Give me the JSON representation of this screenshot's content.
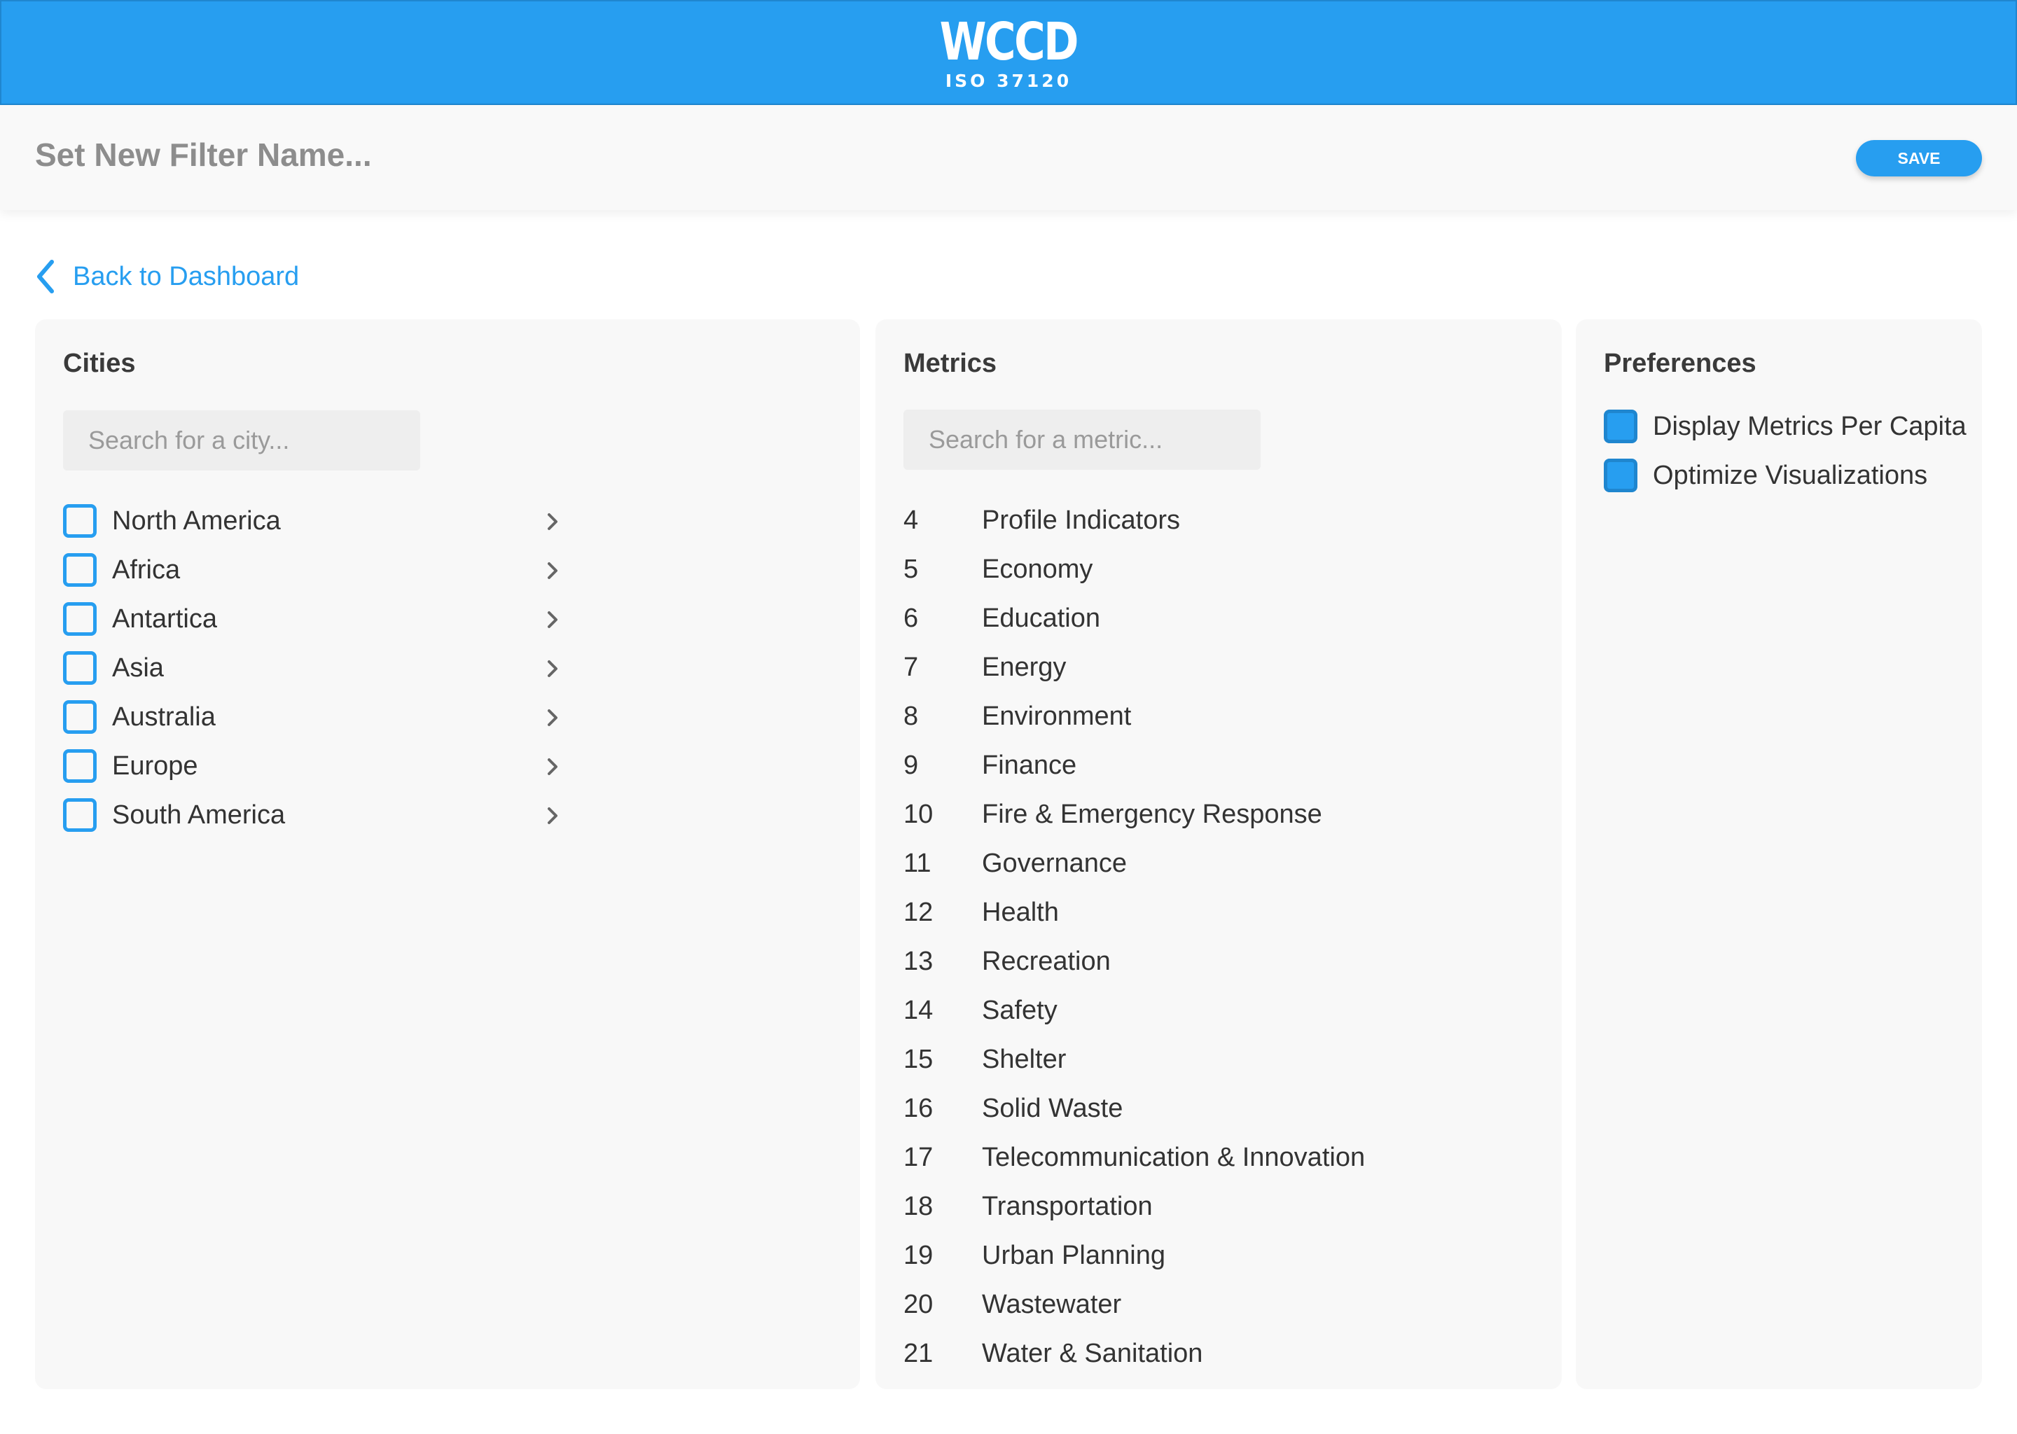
{
  "brand": {
    "name": "WCCD",
    "subtitle": "ISO 37120"
  },
  "header": {
    "filter_name_placeholder": "Set New Filter Name...",
    "save_label": "SAVE"
  },
  "nav": {
    "back_label": "Back to Dashboard"
  },
  "cities": {
    "title": "Cities",
    "search_placeholder": "Search for a city...",
    "regions": [
      {
        "label": "North America",
        "checked": false
      },
      {
        "label": "Africa",
        "checked": false
      },
      {
        "label": "Antartica",
        "checked": false
      },
      {
        "label": "Asia",
        "checked": false
      },
      {
        "label": "Australia",
        "checked": false
      },
      {
        "label": "Europe",
        "checked": false
      },
      {
        "label": "South America",
        "checked": false
      }
    ]
  },
  "metrics": {
    "title": "Metrics",
    "search_placeholder": "Search for a metric...",
    "items": [
      {
        "number": "4",
        "label": "Profile Indicators"
      },
      {
        "number": "5",
        "label": "Economy"
      },
      {
        "number": "6",
        "label": "Education"
      },
      {
        "number": "7",
        "label": "Energy"
      },
      {
        "number": "8",
        "label": "Environment"
      },
      {
        "number": "9",
        "label": "Finance"
      },
      {
        "number": "10",
        "label": "Fire & Emergency Response"
      },
      {
        "number": "11",
        "label": "Governance"
      },
      {
        "number": "12",
        "label": "Health"
      },
      {
        "number": "13",
        "label": "Recreation"
      },
      {
        "number": "14",
        "label": "Safety"
      },
      {
        "number": "15",
        "label": "Shelter"
      },
      {
        "number": "16",
        "label": "Solid Waste"
      },
      {
        "number": "17",
        "label": "Telecommunication & Innovation"
      },
      {
        "number": "18",
        "label": "Transportation"
      },
      {
        "number": "19",
        "label": "Urban Planning"
      },
      {
        "number": "20",
        "label": "Wastewater"
      },
      {
        "number": "21",
        "label": "Water & Sanitation"
      }
    ]
  },
  "preferences": {
    "title": "Preferences",
    "options": [
      {
        "label": "Display Metrics Per Capita",
        "checked": true
      },
      {
        "label": "Optimize Visualizations",
        "checked": true
      }
    ]
  },
  "colors": {
    "accent": "#279ef0",
    "panel_bg": "#f8f8f8",
    "placeholder_text": "#8d8d8d"
  },
  "icons": [
    "chevron-left-icon",
    "chevron-right-icon"
  ]
}
